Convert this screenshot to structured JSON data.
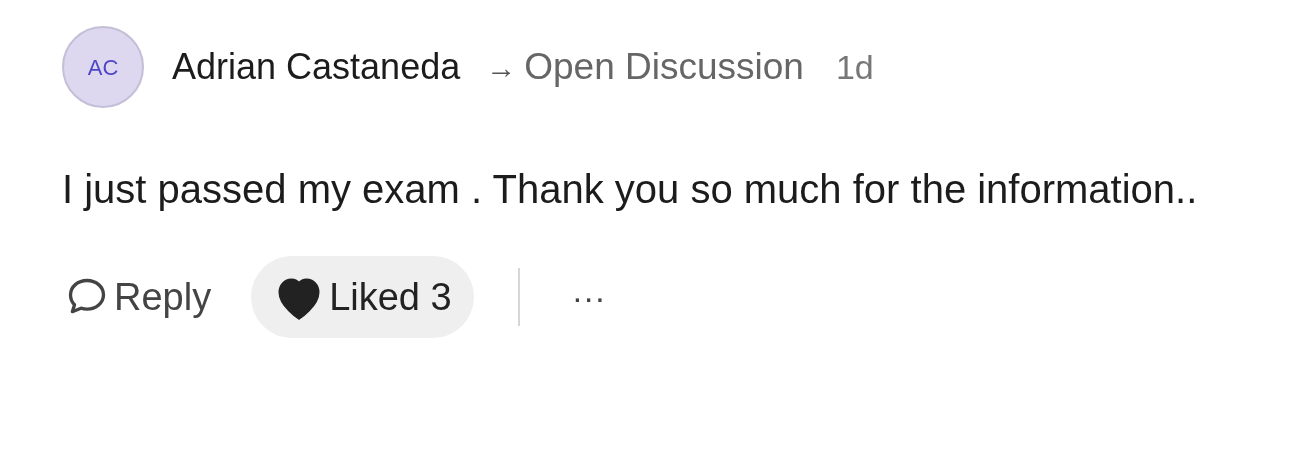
{
  "comment": {
    "avatar": {
      "initials": "AC"
    },
    "author": "Adrian Castaneda",
    "arrow": "→",
    "channel": "Open Discussion",
    "time": "1d",
    "body": "I just passed my exam . Thank you so much for the information..",
    "actions": {
      "reply": "Reply",
      "like": {
        "label": "Liked 3",
        "liked": true
      },
      "more": "···"
    }
  }
}
